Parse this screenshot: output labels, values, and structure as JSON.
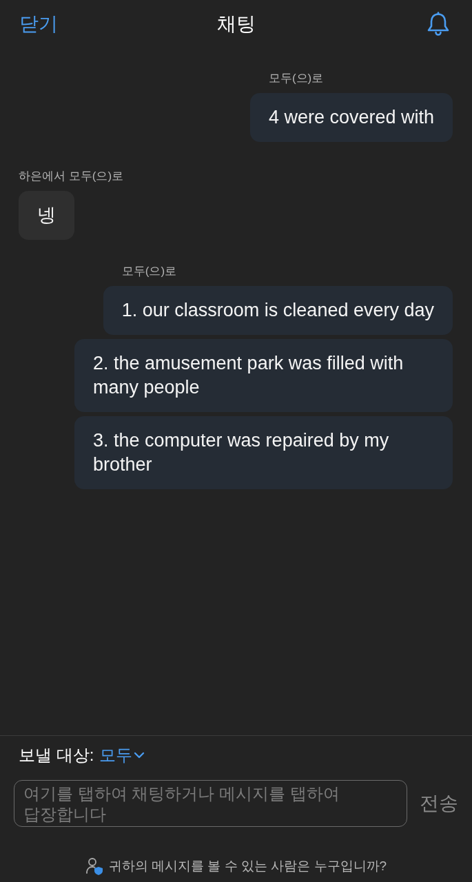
{
  "header": {
    "close_label": "닫기",
    "title": "채팅"
  },
  "messages": [
    {
      "kind": "outgoing",
      "label": "모두(으)로",
      "bubbles": [
        "4 were covered with"
      ]
    },
    {
      "kind": "incoming",
      "label": "하은에서 모두(으)로",
      "bubbles": [
        "넹"
      ]
    },
    {
      "kind": "outgoing",
      "label": "모두(으)로",
      "bubbles": [
        "1. our classroom is cleaned every day",
        "2. the amusement park was filled with many people",
        "3. the computer was repaired by my brother"
      ]
    }
  ],
  "composer": {
    "recipient_label": "보낼 대상:",
    "recipient": "모두",
    "input": {
      "placeholder": "여기를 탭하여 채팅하거나 메시지를 탭하여 답장합니다"
    },
    "send_button": {
      "label": "전송",
      "disabled": true
    }
  },
  "footer": {
    "privacy_link": "귀하의 메시지를 볼 수 있는 사람은 누구입니까?"
  }
}
